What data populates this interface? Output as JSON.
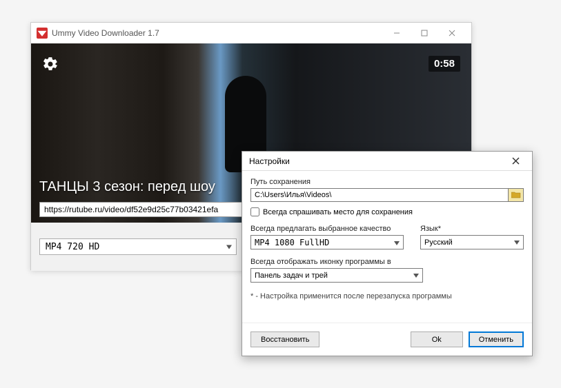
{
  "mainWindow": {
    "title": "Ummy Video Downloader 1.7",
    "videoTitle": "ТАНЦЫ 3 сезон: перед шоу",
    "timer": "0:58",
    "url": "https://rutube.ru/video/df52e9d25c77b03421efa",
    "formatSelected": "MP4  720  HD"
  },
  "settings": {
    "title": "Настройки",
    "savePathLabel": "Путь сохранения",
    "savePath": "C:\\Users\\Илья\\Videos\\",
    "alwaysAskLabel": "Всегда спрашивать место для сохранения",
    "alwaysAskChecked": false,
    "qualityLabel": "Всегда предлагать выбранное качество",
    "qualitySelected": "MP4  1080  FullHD",
    "languageLabel": "Язык*",
    "languageSelected": "Русский",
    "iconLabel": "Всегда отображать иконку программы в",
    "iconSelected": "Панель задач и трей",
    "note": "* - Настройка применится после перезапуска программы",
    "restoreBtn": "Восстановить",
    "okBtn": "Ok",
    "cancelBtn": "Отменить"
  }
}
